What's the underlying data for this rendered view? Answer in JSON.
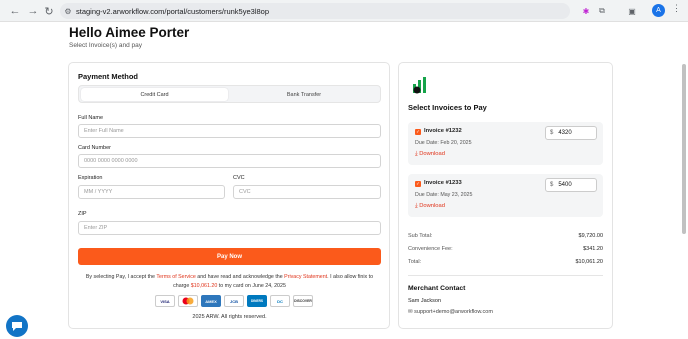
{
  "browser": {
    "url": "staging-v2.arworkflow.com/portal/customers/runk5ye3l8op",
    "avatar_letter": "A"
  },
  "header": {
    "greeting": "Hello Aimee Porter",
    "subtitle": "Select Invoice(s) and pay"
  },
  "payment": {
    "title": "Payment Method",
    "tabs": [
      {
        "label": "Credit Card",
        "active": true
      },
      {
        "label": "Bank Transfer",
        "active": false
      }
    ],
    "full_name": {
      "label": "Full Name",
      "placeholder": "Enter Full Name"
    },
    "card_number": {
      "label": "Card Number",
      "placeholder": "0000 0000 0000 0000"
    },
    "expiration": {
      "label": "Expiration",
      "placeholder": "MM / YYYY"
    },
    "cvc": {
      "label": "CVC",
      "placeholder": "CVC"
    },
    "zip": {
      "label": "ZIP",
      "placeholder": "Enter ZIP"
    },
    "pay_button": "Pay Now",
    "terms": {
      "part1": "By selecting Pay, I accept the ",
      "tos": "Terms of Service",
      "part2": " and have read and acknowledge the ",
      "privacy": "Privacy Statement",
      "part3": ". I also allow finix to charge ",
      "amount": "$10,061.20",
      "part4": " to my card on June 24, 2025"
    },
    "card_brands": [
      "VISA",
      "MC",
      "AMEX",
      "JCB",
      "DINERS",
      "DC",
      "DISCOVER"
    ],
    "copyright": "2025 ARW. All rights reserved."
  },
  "invoices": {
    "title": "Select Invoices to Pay",
    "items": [
      {
        "name": "Invoice #1232",
        "due": "Due Date: Feb 20, 2025",
        "download": "Download",
        "currency": "$",
        "amount": "4320"
      },
      {
        "name": "Invoice #1233",
        "due": "Due Date: May 23, 2025",
        "download": "Download",
        "currency": "$",
        "amount": "5400"
      }
    ],
    "summary": [
      {
        "label": "Sub Total:",
        "value": "$9,720.00"
      },
      {
        "label": "Convenience Fee:",
        "value": "$341.20"
      },
      {
        "label": "Total:",
        "value": "$10,061.20"
      }
    ]
  },
  "merchant": {
    "title": "Merchant Contact",
    "name": "Sam Jackson",
    "email": "support+demo@arworkflow.com"
  },
  "colors": {
    "accent": "#fb5a1b",
    "link": "#e0341b",
    "chat": "#1274c6",
    "logo": "#16a34a"
  }
}
